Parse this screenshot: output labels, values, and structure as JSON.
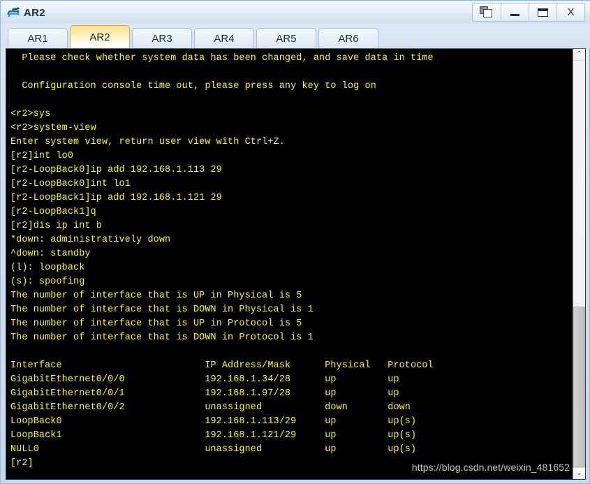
{
  "window": {
    "title": "AR2",
    "app_icon": "router-device-icon",
    "controls": [
      {
        "name": "cascade-windows-button",
        "label": "",
        "icon": "cascade-windows-icon"
      },
      {
        "name": "minimize-button",
        "label": "_",
        "icon": "minimize-icon"
      },
      {
        "name": "maximize-button",
        "label": "",
        "icon": "maximize-icon"
      },
      {
        "name": "close-button",
        "label": "X",
        "icon": "close-icon"
      }
    ]
  },
  "tabs": {
    "active_index": 1,
    "items": [
      {
        "label": "AR1"
      },
      {
        "label": "AR2"
      },
      {
        "label": "AR3"
      },
      {
        "label": "AR4"
      },
      {
        "label": "AR5"
      },
      {
        "label": "AR6"
      }
    ]
  },
  "console": {
    "foreground_color": "#ffff00",
    "background_color": "#000000",
    "prompt": "[r2]",
    "lines": [
      "  Please check whether system data has been changed, and save data in time",
      "",
      "  Configuration console time out, please press any key to log on",
      "",
      "<r2>sys",
      "<r2>system-view",
      "Enter system view, return user view with Ctrl+Z.",
      "[r2]int lo0",
      "[r2-LoopBack0]ip add 192.168.1.113 29",
      "[r2-LoopBack0]int lo1",
      "[r2-LoopBack1]ip add 192.168.1.121 29",
      "[r2-LoopBack1]q",
      "[r2]dis ip int b",
      "*down: administratively down",
      "^down: standby",
      "(l): loopback",
      "(s): spoofing",
      "The number of interface that is UP in Physical is 5",
      "The number of interface that is DOWN in Physical is 1",
      "The number of interface that is UP in Protocol is 5",
      "The number of interface that is DOWN in Protocol is 1",
      "",
      "Interface                         IP Address/Mask      Physical   Protocol",
      "GigabitEthernet0/0/0              192.168.1.34/28      up         up",
      "GigabitEthernet0/0/1              192.168.1.97/28      up         up",
      "GigabitEthernet0/0/2              unassigned           down       down",
      "LoopBack0                         192.168.1.113/29     up         up(s)",
      "LoopBack1                         192.168.1.121/29     up         up(s)",
      "NULL0                             unassigned           up         up(s)",
      "[r2]"
    ],
    "interface_table": {
      "headers": [
        "Interface",
        "IP Address/Mask",
        "Physical",
        "Protocol"
      ],
      "rows": [
        [
          "GigabitEthernet0/0/0",
          "192.168.1.34/28",
          "up",
          "up"
        ],
        [
          "GigabitEthernet0/0/1",
          "192.168.1.97/28",
          "up",
          "up"
        ],
        [
          "GigabitEthernet0/0/2",
          "unassigned",
          "down",
          "down"
        ],
        [
          "LoopBack0",
          "192.168.1.113/29",
          "up",
          "up(s)"
        ],
        [
          "LoopBack1",
          "192.168.1.121/29",
          "up",
          "up(s)"
        ],
        [
          "NULL0",
          "unassigned",
          "up",
          "up(s)"
        ]
      ]
    },
    "counters": {
      "up_physical": 5,
      "down_physical": 1,
      "up_protocol": 5,
      "down_protocol": 1
    },
    "legend": [
      "*down: administratively down",
      "^down: standby",
      "(l): loopback",
      "(s): spoofing"
    ]
  },
  "scrollbar": {
    "up_arrow": "⌃",
    "down_arrow": "⌄"
  },
  "watermark": {
    "text": "https://blog.csdn.net/weixin_481652"
  }
}
